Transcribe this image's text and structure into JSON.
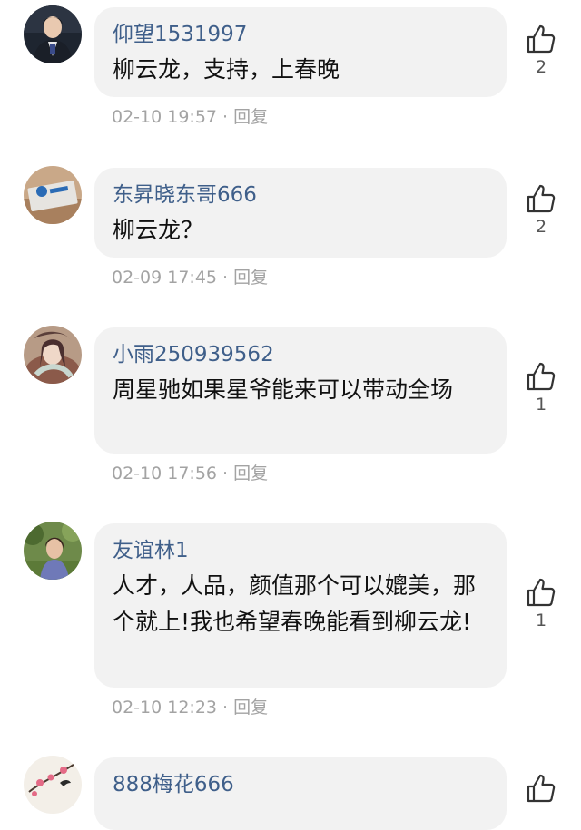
{
  "comments": [
    {
      "username": "仰望1531997",
      "text": "柳云龙，支持，上春晚",
      "time": "02-10 19:57",
      "separator": "·",
      "reply": "回复",
      "likes": "2"
    },
    {
      "username": "东昇晓东哥666",
      "text": "柳云龙？",
      "time": "02-09 17:45",
      "separator": "·",
      "reply": "回复",
      "likes": "2"
    },
    {
      "username": "小雨250939562",
      "text": "周星驰如果星爷能来可以带动全场",
      "time": "02-10 17:56",
      "separator": "·",
      "reply": "回复",
      "likes": "1"
    },
    {
      "username": "友谊林1",
      "text": "人才，人品，颜值那个可以媲美，那个就上!我也希望春晚能看到柳云龙!",
      "time": "02-10 12:23",
      "separator": "·",
      "reply": "回复",
      "likes": "1"
    },
    {
      "username": "888梅花666",
      "text": "",
      "time": "",
      "separator": "",
      "reply": "",
      "likes": ""
    }
  ],
  "icons": {
    "like": "thumbs-up-icon",
    "avatar": "user-avatar"
  }
}
